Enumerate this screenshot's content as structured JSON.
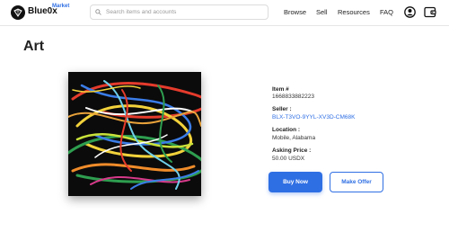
{
  "brand": {
    "name": "Blue0x",
    "sub": "Market"
  },
  "search": {
    "placeholder": "Search items and accounts"
  },
  "nav": {
    "browse": "Browse",
    "sell": "Sell",
    "resources": "Resources",
    "faq": "FAQ"
  },
  "icons": {
    "logo": "diamond-logo-icon",
    "search": "search-icon",
    "user": "user-account-icon",
    "wallet": "wallet-icon"
  },
  "page": {
    "title": "Art"
  },
  "item": {
    "number_label": "Item #",
    "number": "1668833882223",
    "seller_label": "Seller :",
    "seller": "BLX-T3VO-9YYL-XV3D-CM68K",
    "location_label": "Location :",
    "location": "Mobile, Alabama",
    "price_label": "Asking Price :",
    "price": "50.00 USDX"
  },
  "actions": {
    "buy": "Buy Now",
    "offer": "Make Offer"
  },
  "colors": {
    "accent": "#2f6fe4",
    "text": "#222222",
    "border": "#e6e6e6"
  }
}
